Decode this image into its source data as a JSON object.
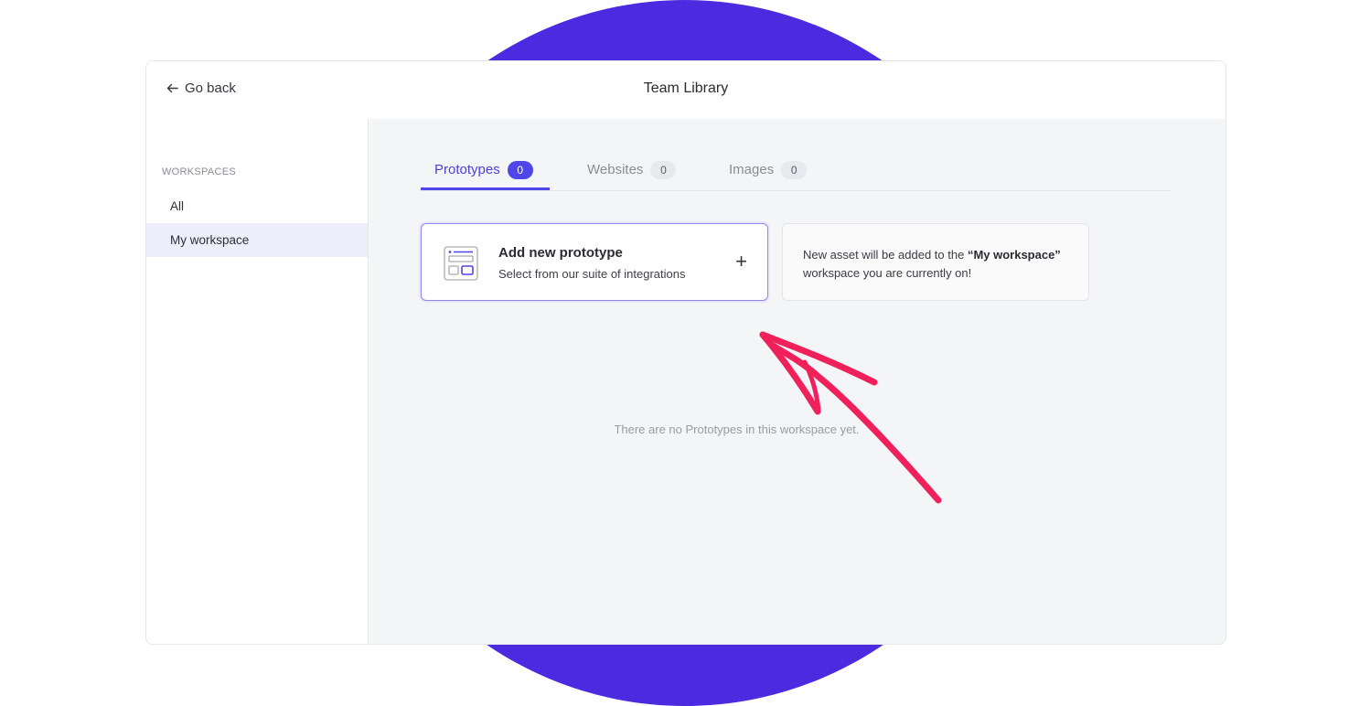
{
  "header": {
    "back_label": "Go back",
    "title": "Team Library"
  },
  "sidebar": {
    "heading": "WORKSPACES",
    "items": [
      {
        "label": "All"
      },
      {
        "label": "My workspace"
      }
    ]
  },
  "tabs": [
    {
      "label": "Prototypes",
      "count": "0"
    },
    {
      "label": "Websites",
      "count": "0"
    },
    {
      "label": "Images",
      "count": "0"
    }
  ],
  "add_card": {
    "title": "Add new prototype",
    "subtitle": "Select from our suite of integrations",
    "plus": "+"
  },
  "info_card": {
    "text_before": "New asset will be added to the ",
    "workspace_name": "“My workspace”",
    "text_after": "workspace you are currently on!"
  },
  "empty_state": "There are no Prototypes in this workspace yet.",
  "colors": {
    "accent": "#4f45e8",
    "background_circle": "#4b2ae0",
    "annotation_arrow": "#f0215a"
  }
}
